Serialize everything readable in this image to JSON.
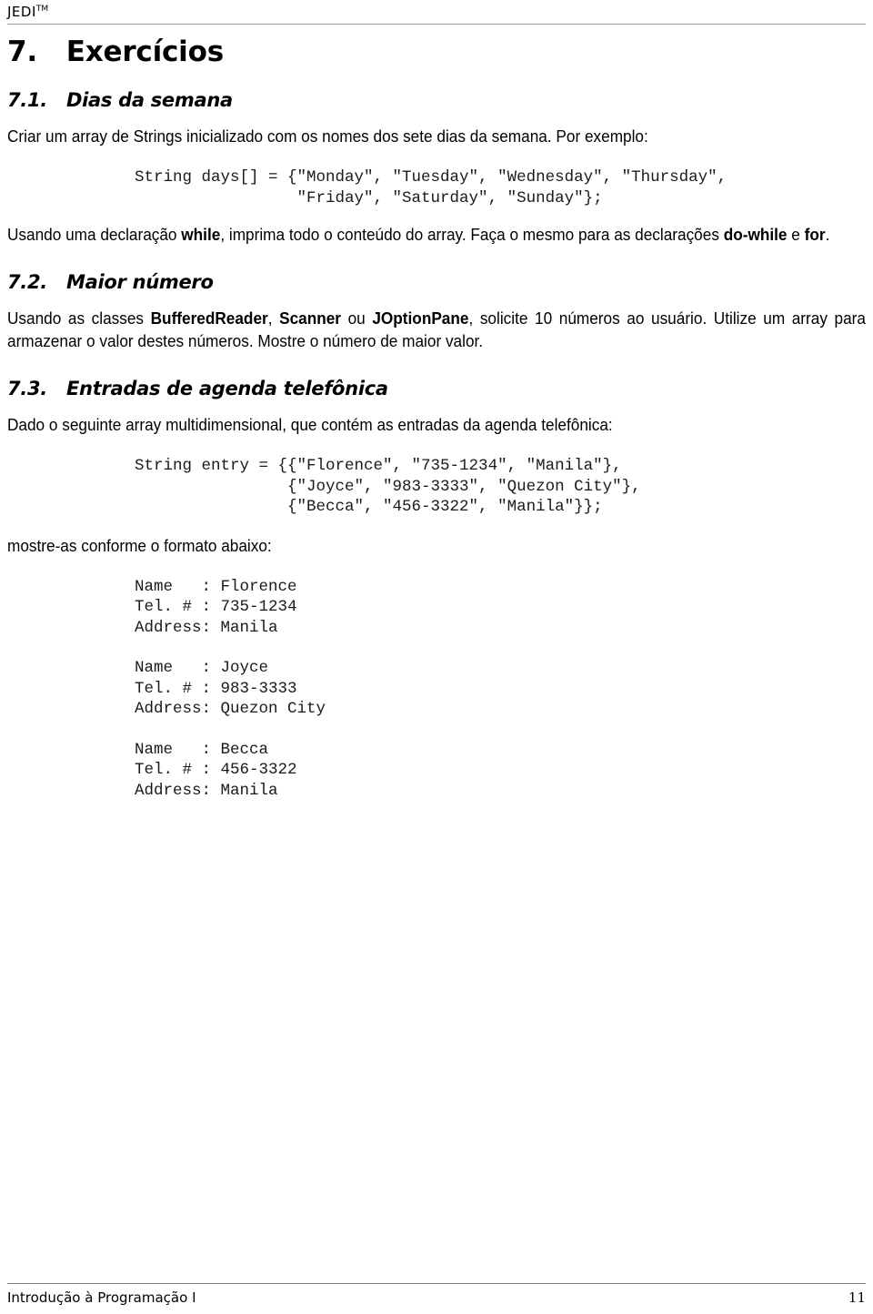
{
  "header": {
    "brand": "JEDI",
    "trademark": "TM"
  },
  "chapter": {
    "number": "7.",
    "title": "Exercícios",
    "heading": "7.   Exercícios"
  },
  "sections": [
    {
      "number": "7.1.",
      "title": "Dias da semana",
      "heading": "7.1.   Dias da semana",
      "intro_before": "Criar um array de Strings inicializado com os nomes dos sete dias da semana. Por exemplo:",
      "code": "String days[] = {\"Monday\", \"Tuesday\", \"Wednesday\", \"Thursday\",\n                 \"Friday\", \"Saturday\", \"Sunday\"};",
      "after_1": "Usando uma declaração ",
      "after_kw_1": "while",
      "after_2": ", imprima todo o conteúdo do array. Faça o mesmo para as declarações ",
      "after_kw_2": "do-while",
      "after_3": " e ",
      "after_kw_3": "for",
      "after_4": "."
    },
    {
      "number": "7.2.",
      "title": "Maior número",
      "heading": "7.2.   Maior número",
      "body_1": "Usando as classes ",
      "cls_1": "BufferedReader",
      "body_2": ", ",
      "cls_2": "Scanner",
      "body_3": " ou ",
      "cls_3": "JOptionPane",
      "body_4": ", solicite 10 números ao usuário. Utilize um array para armazenar o valor destes números. Mostre o número de maior valor."
    },
    {
      "number": "7.3.",
      "title": "Entradas de agenda telefônica",
      "heading": "7.3.   Entradas de agenda telefônica",
      "intro": "Dado o seguinte array multidimensional, que contém as entradas da agenda telefônica:",
      "code": "String entry = {{\"Florence\", \"735-1234\", \"Manila\"},\n                {\"Joyce\", \"983-3333\", \"Quezon City\"},\n                {\"Becca\", \"456-3322\", \"Manila\"}};",
      "outro": "mostre-as conforme o formato abaixo:",
      "output_block_1": "Name   : Florence\nTel. # : 735-1234\nAddress: Manila",
      "output_block_2": "Name   : Joyce\nTel. # : 983-3333\nAddress: Quezon City",
      "output_block_3": "Name   : Becca\nTel. # : 456-3322\nAddress: Manila",
      "entries": [
        {
          "name": "Florence",
          "tel": "735-1234",
          "address": "Manila"
        },
        {
          "name": "Joyce",
          "tel": "983-3333",
          "address": "Quezon City"
        },
        {
          "name": "Becca",
          "tel": "456-3322",
          "address": "Manila"
        }
      ],
      "labels": {
        "name": "Name",
        "tel": "Tel. #",
        "address": "Address"
      }
    }
  ],
  "footer": {
    "title": "Introdução à Programação I",
    "page": "11"
  },
  "colors": {
    "text": "#000000",
    "code": "#1a1a1a",
    "rule": "#9a9a9a",
    "footer_rule": "#7a7a7a",
    "background": "#ffffff"
  }
}
